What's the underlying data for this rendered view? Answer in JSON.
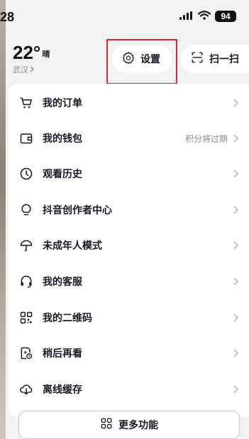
{
  "status_bar": {
    "time": "28",
    "battery": "94"
  },
  "weather": {
    "temperature": "22°",
    "condition": "晴",
    "city": "武汉"
  },
  "header": {
    "settings_label": "设置",
    "scan_label": "扫一扫"
  },
  "menu": {
    "items": [
      {
        "label": "我的订单",
        "icon": "cart-icon",
        "hint": ""
      },
      {
        "label": "我的钱包",
        "icon": "wallet-icon",
        "hint": "积分将过期"
      },
      {
        "label": "观看历史",
        "icon": "clock-icon",
        "hint": ""
      },
      {
        "label": "抖音创作者中心",
        "icon": "bulb-icon",
        "hint": ""
      },
      {
        "label": "未成年人模式",
        "icon": "umbrella-icon",
        "hint": ""
      },
      {
        "label": "我的客服",
        "icon": "headset-icon",
        "hint": ""
      },
      {
        "label": "我的二维码",
        "icon": "qrcode-icon",
        "hint": ""
      },
      {
        "label": "稍后再看",
        "icon": "watch-later-icon",
        "hint": ""
      },
      {
        "label": "离线缓存",
        "icon": "download-cloud-icon",
        "hint": ""
      }
    ]
  },
  "more": {
    "label": "更多功能"
  },
  "colors": {
    "highlight": "#e0242a",
    "text": "#161823",
    "muted": "#8a8a8f"
  }
}
